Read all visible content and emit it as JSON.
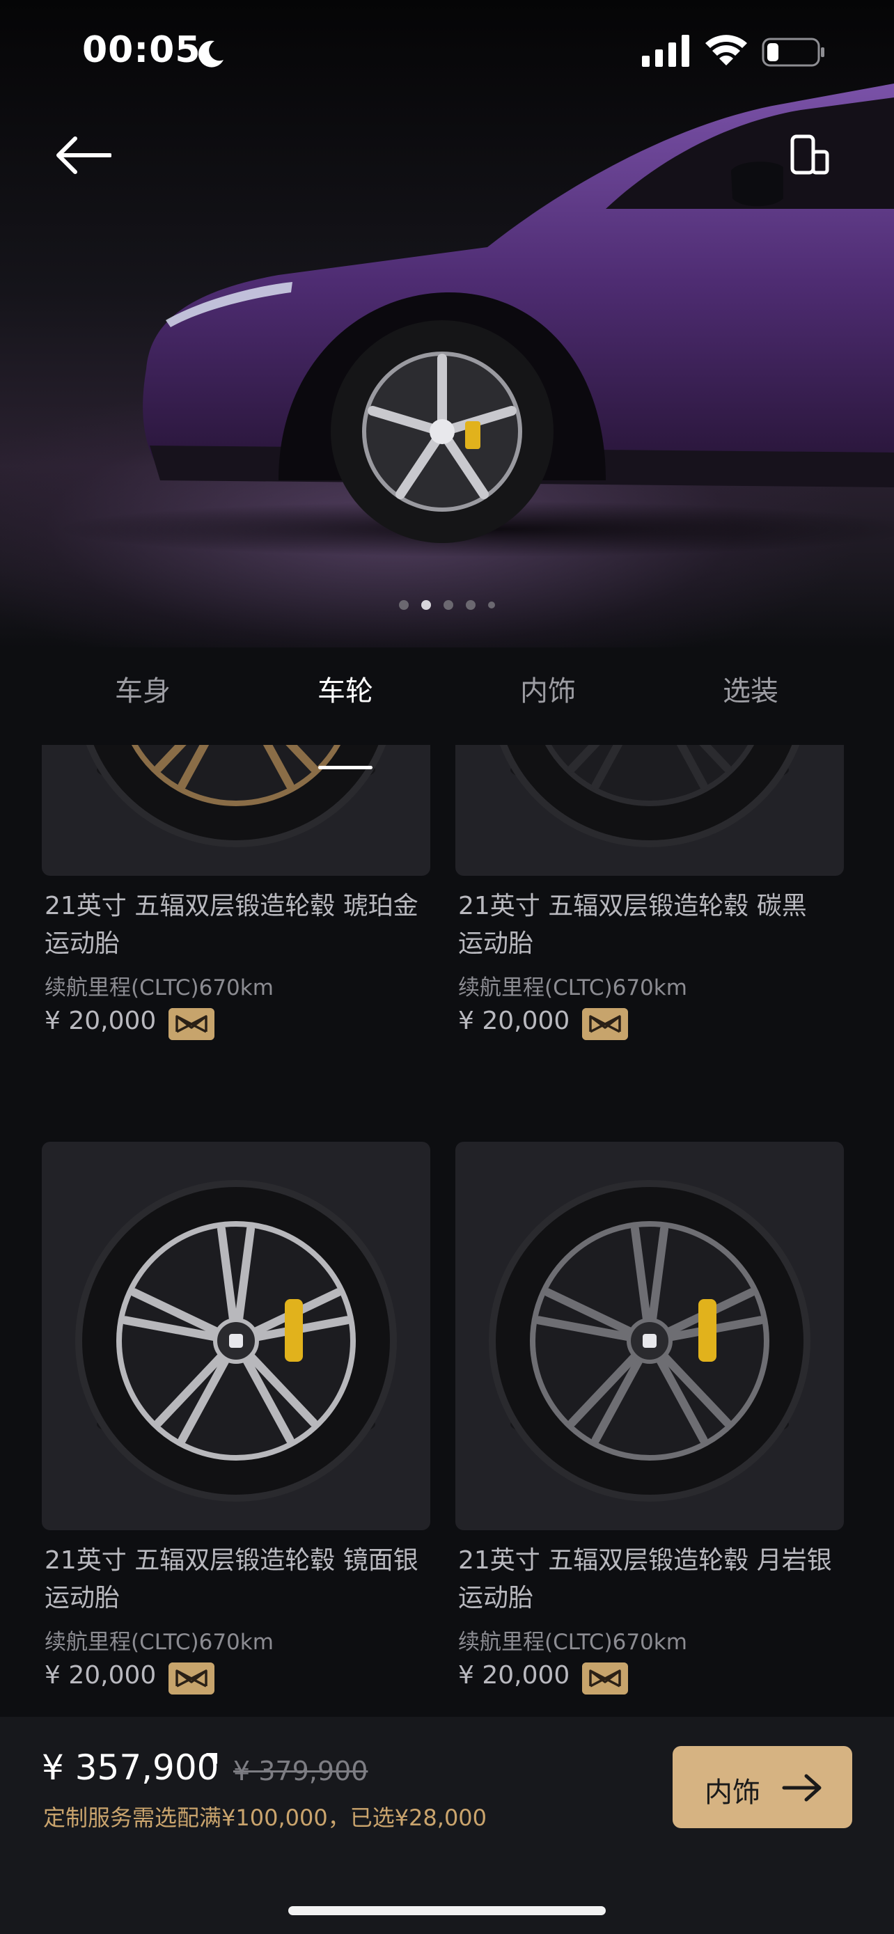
{
  "status_bar": {
    "time": "00:05"
  },
  "header": {
    "back_icon": "arrow-left-icon",
    "device_icon": "phone-device-icon"
  },
  "carousel": {
    "count": 5,
    "active_index": 1
  },
  "tabs": [
    {
      "label": "车身",
      "active": false
    },
    {
      "label": "车轮",
      "active": true
    },
    {
      "label": "内饰",
      "active": false
    },
    {
      "label": "选装",
      "active": false
    }
  ],
  "wheels": [
    {
      "title_line1": "21英寸 五辐双层锻造轮毂 琥珀金",
      "title_line2": "运动胎",
      "range": "续航里程(CLTC)670km",
      "price": "¥ 20,000",
      "finish": "#8a6d47"
    },
    {
      "title_line1": "21英寸 五辐双层锻造轮毂 碳黑",
      "title_line2": "运动胎",
      "range": "续航里程(CLTC)670km",
      "price": "¥ 20,000",
      "finish": "#2b2b2f"
    },
    {
      "title_line1": "21英寸 五辐双层锻造轮毂 镜面银",
      "title_line2": "运动胎",
      "range": "续航里程(CLTC)670km",
      "price": "¥ 20,000",
      "finish": "#b8b8bc"
    },
    {
      "title_line1": "21英寸 五辐双层锻造轮毂 月岩银",
      "title_line2": "运动胎",
      "range": "续航里程(CLTC)670km",
      "price": "¥ 20,000",
      "finish": "#6e6e73"
    }
  ],
  "footer": {
    "total_price": "¥ 357,900",
    "original_price": "¥ 379,900",
    "note": "定制服务需选配满¥100,000，已选¥28,000",
    "next_label": "内饰"
  },
  "colors": {
    "accent_gold": "#d6b382",
    "car_purple": "#4a2a6e",
    "caliper": "#e1b21c"
  }
}
